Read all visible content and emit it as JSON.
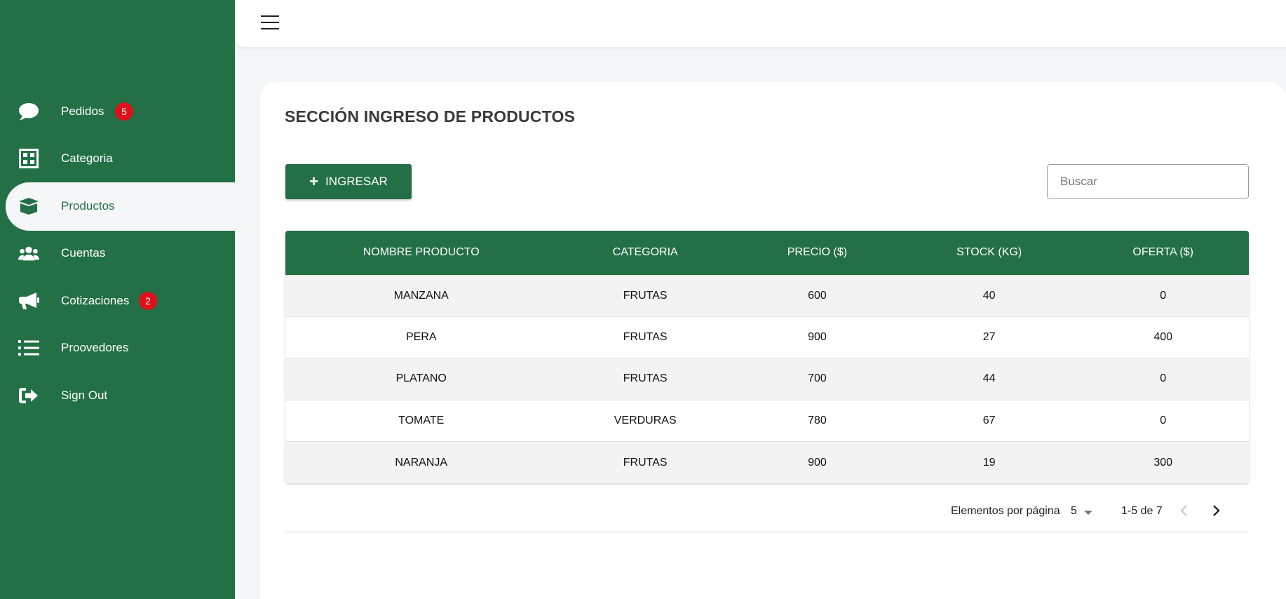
{
  "colors": {
    "primary": "#237046",
    "badge": "#e0101b",
    "background": "#f5f6f8"
  },
  "sidebar": {
    "items": [
      {
        "label": "Pedidos",
        "icon": "chat-bubble-icon",
        "badge": "5"
      },
      {
        "label": "Categoria",
        "icon": "grid-icon"
      },
      {
        "label": "Productos",
        "icon": "box-icon",
        "active": true
      },
      {
        "label": "Cuentas",
        "icon": "users-icon"
      },
      {
        "label": "Cotizaciones",
        "icon": "megaphone-icon",
        "badge": "2"
      },
      {
        "label": "Proovedores",
        "icon": "list-icon"
      },
      {
        "label": "Sign Out",
        "icon": "sign-out-icon"
      }
    ]
  },
  "topbar": {
    "menu_icon": "hamburger-menu-icon"
  },
  "main": {
    "title": "SECCIÓN INGRESO DE PRODUCTOS",
    "add_button": {
      "label": "INGRESAR",
      "icon": "plus-icon"
    },
    "search": {
      "placeholder": "Buscar",
      "value": ""
    },
    "table": {
      "columns": [
        "NOMBRE PRODUCTO",
        "CATEGORIA",
        "PRECIO ($)",
        "STOCK (KG)",
        "OFERTA ($)"
      ],
      "rows": [
        [
          "MANZANA",
          "FRUTAS",
          "600",
          "40",
          "0"
        ],
        [
          "PERA",
          "FRUTAS",
          "900",
          "27",
          "400"
        ],
        [
          "PLATANO",
          "FRUTAS",
          "700",
          "44",
          "0"
        ],
        [
          "TOMATE",
          "VERDURAS",
          "780",
          "67",
          "0"
        ],
        [
          "NARANJA",
          "FRUTAS",
          "900",
          "19",
          "300"
        ]
      ]
    },
    "paginator": {
      "label": "Elementos por página",
      "page_size": "5",
      "range": "1-5 de 7"
    }
  }
}
